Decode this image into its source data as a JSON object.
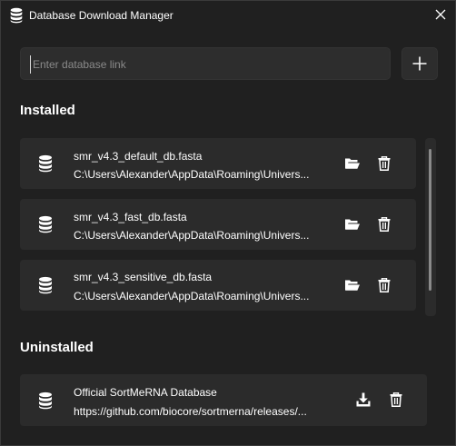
{
  "window": {
    "title": "Database Download Manager",
    "icon": "database-icon",
    "close_icon": "close-icon"
  },
  "search": {
    "placeholder": "Enter database link",
    "value": ""
  },
  "add_button": {
    "icon": "plus-icon"
  },
  "installed": {
    "heading": "Installed",
    "items": [
      {
        "name": "smr_v4.3_default_db.fasta",
        "path": "C:\\Users\\Alexander\\AppData\\Roaming\\Univers..."
      },
      {
        "name": "smr_v4.3_fast_db.fasta",
        "path": "C:\\Users\\Alexander\\AppData\\Roaming\\Univers..."
      },
      {
        "name": "smr_v4.3_sensitive_db.fasta",
        "path": "C:\\Users\\Alexander\\AppData\\Roaming\\Univers..."
      }
    ],
    "actions": [
      "folder-open-icon",
      "trash-icon"
    ]
  },
  "uninstalled": {
    "heading": "Uninstalled",
    "items": [
      {
        "name": "Official SortMeRNA Database",
        "path": "https://github.com/biocore/sortmerna/releases/..."
      }
    ],
    "actions": [
      "download-icon",
      "trash-icon"
    ]
  },
  "colors": {
    "background": "#202020",
    "card": "#2b2b2b",
    "input": "#2d2d2d",
    "text": "#ffffff",
    "placeholder": "#8a8a8a"
  }
}
